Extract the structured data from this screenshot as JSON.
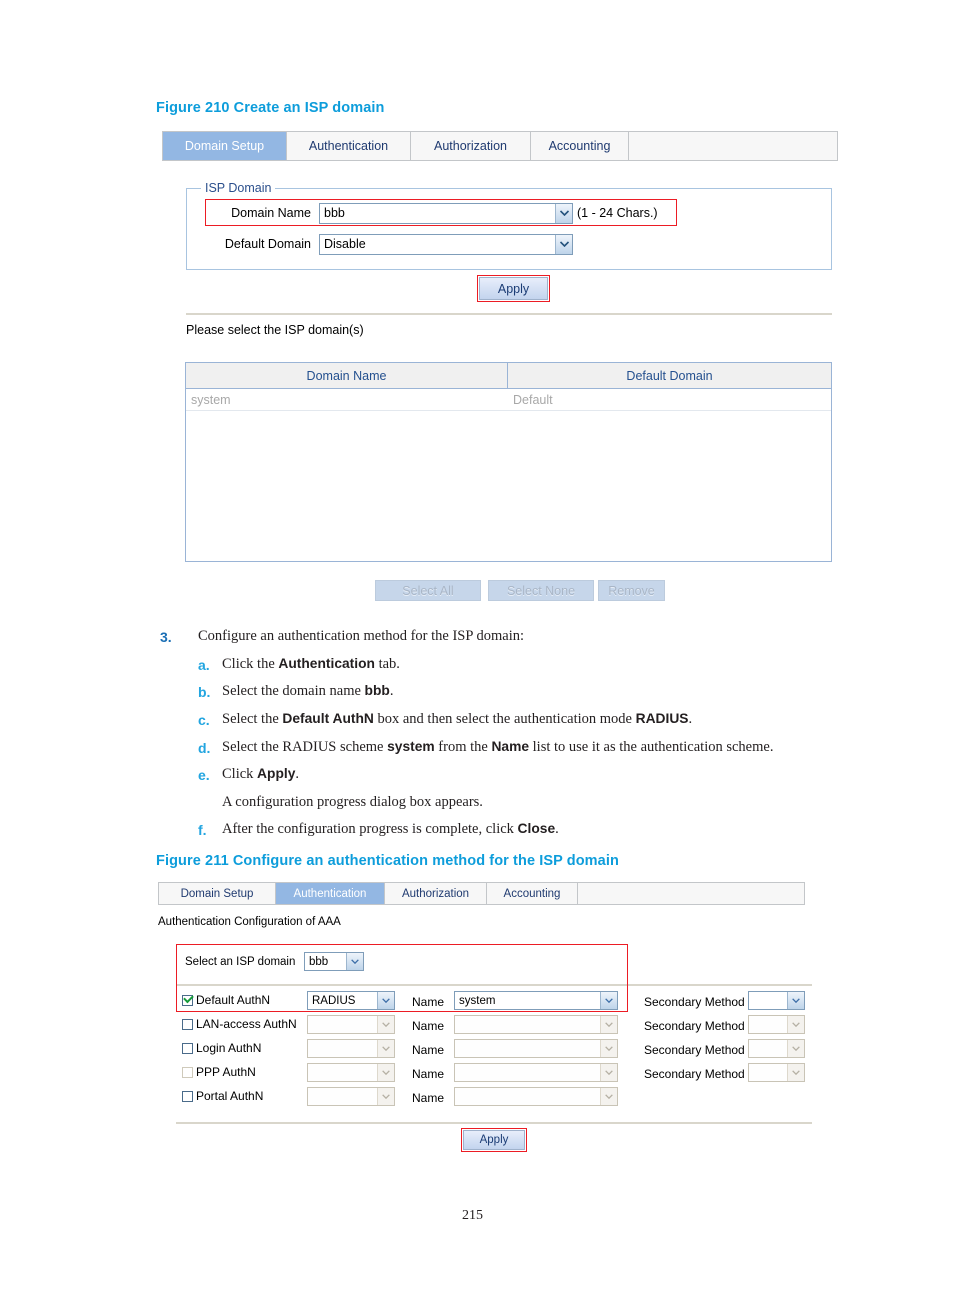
{
  "page": {
    "number": "215"
  },
  "figure210": {
    "caption": "Figure 210 Create an ISP domain",
    "tabs": [
      {
        "label": "Domain Setup",
        "active": true
      },
      {
        "label": "Authentication",
        "active": false
      },
      {
        "label": "Authorization",
        "active": false
      },
      {
        "label": "Accounting",
        "active": false
      }
    ],
    "fieldset": {
      "legend": "ISP Domain",
      "rows": [
        {
          "label": "Domain Name",
          "value": "bbb",
          "hint": "(1 - 24 Chars.)"
        },
        {
          "label": "Default Domain",
          "value": "Disable",
          "hint": ""
        }
      ]
    },
    "apply_label": "Apply",
    "list_prompt": "Please select the ISP domain(s)",
    "table": {
      "headers": [
        "Domain Name",
        "Default Domain"
      ],
      "rows": [
        [
          "system",
          "Default"
        ]
      ]
    },
    "footer_buttons": [
      {
        "label": "Select All"
      },
      {
        "label": "Select None"
      },
      {
        "label": "Remove"
      }
    ]
  },
  "steps": {
    "step3": {
      "num": "3.",
      "text": "Configure an authentication method for the ISP domain:"
    },
    "substeps": [
      {
        "letter": "a.",
        "html": "Click the <b>Authentication</b> tab."
      },
      {
        "letter": "b.",
        "html": "Select the domain name <b>bbb</b>."
      },
      {
        "letter": "c.",
        "html": "Select the <b>Default AuthN</b> box and then select the authentication mode <b>RADIUS</b>."
      },
      {
        "letter": "d.",
        "html": "Select the RADIUS scheme <b>system</b> from the <b>Name</b> list to use it as the authentication scheme."
      },
      {
        "letter": "e.",
        "html": "Click <b>Apply</b>."
      },
      {
        "letter": "",
        "html": "A configuration progress dialog box appears."
      },
      {
        "letter": "f.",
        "html": "After the configuration progress is complete, click <b>Close</b>."
      }
    ]
  },
  "figure211": {
    "caption": "Figure 211 Configure an authentication method for the ISP domain",
    "tabs": [
      {
        "label": "Domain Setup",
        "active": false
      },
      {
        "label": "Authentication",
        "active": true
      },
      {
        "label": "Authorization",
        "active": false
      },
      {
        "label": "Accounting",
        "active": false
      }
    ],
    "section_title": "Authentication Configuration of AAA",
    "isp_select": {
      "label": "Select an ISP domain",
      "value": "bbb"
    },
    "name_label": "Name",
    "secondary_label": "Secondary Method",
    "auth_rows": [
      {
        "label": "Default AuthN",
        "checked": true,
        "enabled": true,
        "method": "RADIUS",
        "name": "system",
        "has_secondary": true,
        "secondary": ""
      },
      {
        "label": "LAN-access AuthN",
        "checked": false,
        "enabled": false,
        "method": "",
        "name": "",
        "has_secondary": true,
        "secondary": ""
      },
      {
        "label": "Login AuthN",
        "checked": false,
        "enabled": false,
        "method": "",
        "name": "",
        "has_secondary": true,
        "secondary": ""
      },
      {
        "label": "PPP AuthN",
        "checked": false,
        "enabled": false,
        "method": "",
        "name": "",
        "has_secondary": true,
        "secondary": ""
      },
      {
        "label": "Portal AuthN",
        "checked": false,
        "enabled": false,
        "method": "",
        "name": "",
        "has_secondary": false,
        "secondary": ""
      }
    ],
    "apply_label": "Apply"
  },
  "colors": {
    "caption": "#0d9ddb",
    "active_tab_bg": "#93b7e3",
    "annotation_red": "#ec1c24",
    "step_number": "#1b6fb5",
    "substep_letter": "#22a5e0"
  }
}
